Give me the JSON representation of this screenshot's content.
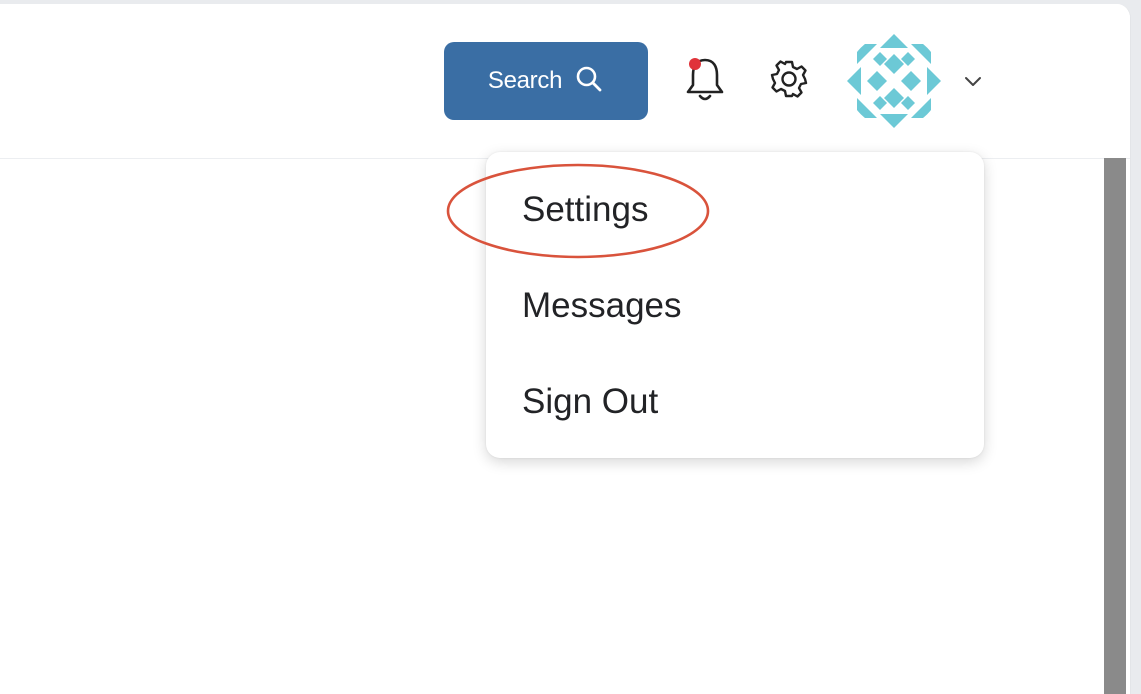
{
  "header": {
    "search_label": "Search",
    "icons": {
      "search": "search-icon",
      "notifications": "bell-icon",
      "settings": "gear-icon",
      "avatar": "avatar-pattern",
      "dropdown": "chevron-down-icon"
    },
    "notification_dot": true
  },
  "user_menu": {
    "items": [
      {
        "label": "Settings",
        "highlighted": true
      },
      {
        "label": "Messages"
      },
      {
        "label": "Sign Out"
      }
    ]
  },
  "colors": {
    "primary": "#3a6ea4",
    "notification": "#e0333a",
    "avatar": "#6cc9d6",
    "highlight": "#d9533c"
  }
}
